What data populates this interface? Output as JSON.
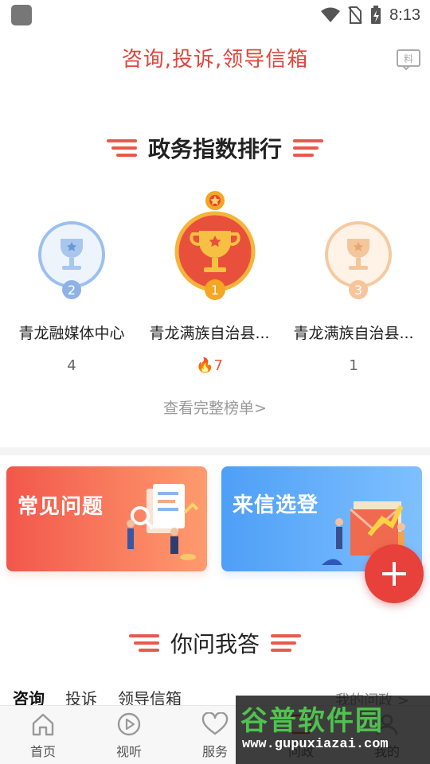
{
  "statusbar": {
    "time": "8:13"
  },
  "header": {
    "title": "咨询,投诉,领导信箱",
    "badge_icon": "news-badge-icon"
  },
  "ranking": {
    "title": "政务指数排行",
    "items": [
      {
        "rank": "2",
        "name": "青龙融媒体中心",
        "score": "4",
        "hot": false
      },
      {
        "rank": "1",
        "name": "青龙满族自治县...",
        "score": "7",
        "hot": true
      },
      {
        "rank": "3",
        "name": "青龙满族自治县...",
        "score": "1",
        "hot": false
      }
    ],
    "view_all": "查看完整榜单>"
  },
  "cards": {
    "faq": "常见问题",
    "letters": "来信选登"
  },
  "qa": {
    "title": "你问我答",
    "tabs": [
      "咨询",
      "投诉",
      "领导信箱"
    ],
    "my_gov": "我的问政 >"
  },
  "bottom_nav": [
    {
      "label": "首页",
      "icon": "home-icon"
    },
    {
      "label": "视听",
      "icon": "play-icon"
    },
    {
      "label": "服务",
      "icon": "heart-icon"
    },
    {
      "label": "问政",
      "icon": "gov-icon"
    },
    {
      "label": "我的",
      "icon": "user-icon"
    }
  ],
  "watermark": {
    "title": "谷普软件园",
    "url": "www.gupuxiazai.com"
  },
  "colors": {
    "accent": "#e0463c",
    "gold": "#f5a623",
    "silver": "#8fb6ea",
    "bronze": "#f6c9a0"
  }
}
